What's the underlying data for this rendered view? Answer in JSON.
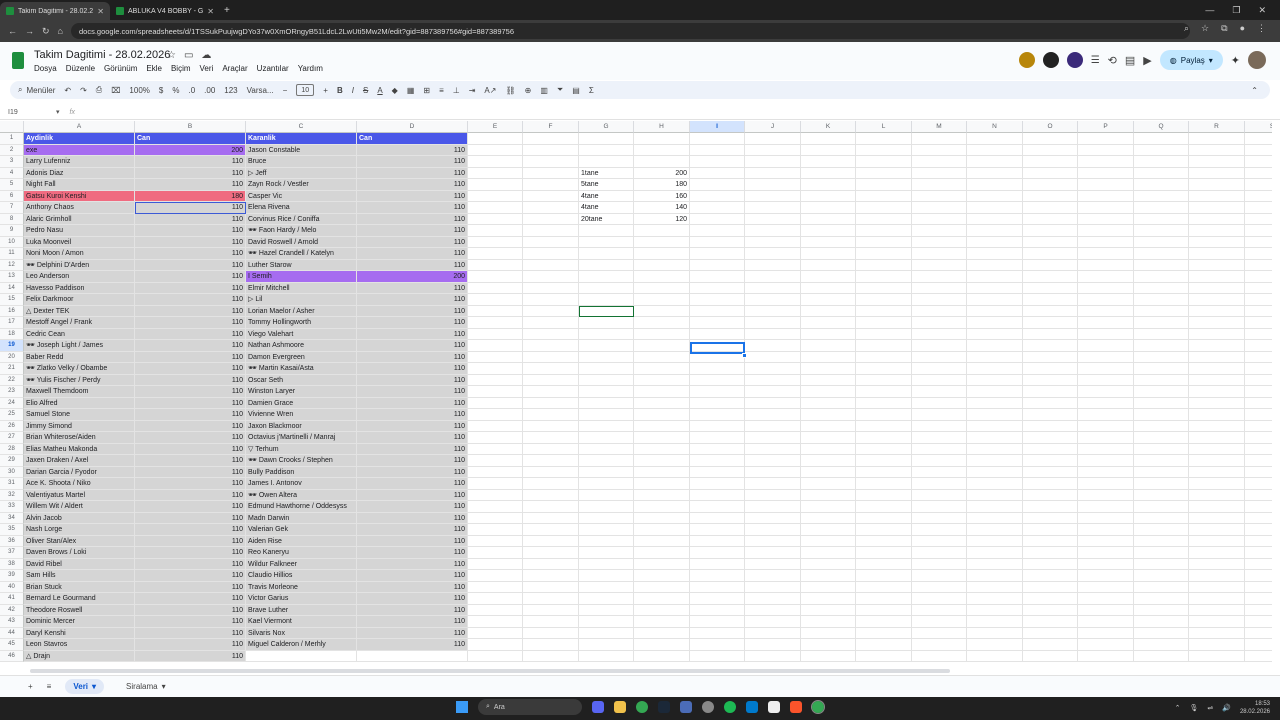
{
  "browser": {
    "tabs": [
      {
        "title": "Takim Dagitimi - 28.02.2026 - G",
        "active": true
      },
      {
        "title": "ABLUKA V4 BOBBY - Google E",
        "active": false
      }
    ],
    "url": "docs.google.com/spreadsheets/d/1TSSukPuujwgDYo37w0XmORngyB51LdcL2LwUti5Mw2M/edit?gid=887389756#gid=887389756"
  },
  "doc": {
    "title": "Takim Dagitimi - 28.02.2026",
    "menu": [
      "Dosya",
      "Düzenle",
      "Görünüm",
      "Ekle",
      "Biçim",
      "Veri",
      "Araçlar",
      "Uzantılar",
      "Yardım"
    ],
    "share_label": "Paylaş"
  },
  "toolbar": {
    "menus_label": "Menüler",
    "zoom": "100%",
    "currency": "$",
    "percent": "%",
    "dec_less": ".0",
    "dec_more": ".00",
    "number_format": "123",
    "font": "Varsa...",
    "font_size": "10"
  },
  "formula": {
    "cell_ref": "I19",
    "fx": "fx",
    "value": ""
  },
  "columns": [
    "A",
    "B",
    "C",
    "D",
    "E",
    "F",
    "G",
    "H",
    "I",
    "J",
    "K",
    "L",
    "M",
    "N",
    "O",
    "P",
    "Q",
    "R",
    "S"
  ],
  "selected_column": "I",
  "selected_row": 19,
  "headers": {
    "a": "Aydinlik",
    "b": "Can",
    "c": "Karanlik",
    "d": "Can"
  },
  "rows": [
    {
      "a": "exe",
      "b": "200",
      "c": "Jason Constable",
      "d": "110"
    },
    {
      "a": "Larry Lufenniz",
      "b": "110",
      "c": "Bruce",
      "d": "110"
    },
    {
      "a": "Adonis Diaz",
      "b": "110",
      "c": "▷ Jeff",
      "d": "110"
    },
    {
      "a": "Night Fall",
      "b": "110",
      "c": "Zayn Rock / Vestler",
      "d": "110"
    },
    {
      "a": "Gatsu Kuroi Kenshi",
      "b": "180",
      "c": "Casper Vic",
      "d": "110"
    },
    {
      "a": "Anthony Chaos",
      "b": "110",
      "c": "Elena Rivena",
      "d": "110"
    },
    {
      "a": "Alaric Grimholl",
      "b": "110",
      "c": "Corvinus Rice / Coniffa",
      "d": "110"
    },
    {
      "a": "Pedro Nasu",
      "b": "110",
      "c": "🕶 Faon Hardy / Melo",
      "d": "110"
    },
    {
      "a": "Luka Moonveil",
      "b": "110",
      "c": "David Roswell / Arnold",
      "d": "110"
    },
    {
      "a": "Noni Moon / Amon",
      "b": "110",
      "c": "🕶 Hazel Crandell / Katelyn",
      "d": "110"
    },
    {
      "a": "🕶 Delphini D'Arden",
      "b": "110",
      "c": "Luther Starow",
      "d": "110"
    },
    {
      "a": "Leo Anderson",
      "b": "110",
      "c": "I Semih",
      "d": "200"
    },
    {
      "a": "Havesso Paddison",
      "b": "110",
      "c": "Elmir Mitchell",
      "d": "110"
    },
    {
      "a": "Felix Darkmoor",
      "b": "110",
      "c": "▷ Lil",
      "d": "110"
    },
    {
      "a": "△ Dexter TEK",
      "b": "110",
      "c": "Lorian Maelor / Asher",
      "d": "110"
    },
    {
      "a": "Mestoff Angel / Frank",
      "b": "110",
      "c": "Tommy Hollingworth",
      "d": "110"
    },
    {
      "a": "Cedric Cean",
      "b": "110",
      "c": "Viego Valehart",
      "d": "110"
    },
    {
      "a": "🕶 Joseph Light / James",
      "b": "110",
      "c": "Nathan Ashmoore",
      "d": "110"
    },
    {
      "a": "Baber Redd",
      "b": "110",
      "c": "Damon Evergreen",
      "d": "110"
    },
    {
      "a": "🕶 Zlatko Velky / Obambe",
      "b": "110",
      "c": "🕶 Martin Kasai/Asta",
      "d": "110"
    },
    {
      "a": "🕶 Yulis Fischer / Perdy",
      "b": "110",
      "c": "Oscar Seth",
      "d": "110"
    },
    {
      "a": "Maxwell Themdoom",
      "b": "110",
      "c": "Winston Laryer",
      "d": "110"
    },
    {
      "a": "Elio Alfred",
      "b": "110",
      "c": "Damien Grace",
      "d": "110"
    },
    {
      "a": "Samuel Stone",
      "b": "110",
      "c": "Vivienne Wren",
      "d": "110"
    },
    {
      "a": "Jimmy Simond",
      "b": "110",
      "c": "Jaxon Blackmoor",
      "d": "110"
    },
    {
      "a": "Brian Whiterose/Aiden",
      "b": "110",
      "c": "Octavius j'Martinelli / Manraj",
      "d": "110"
    },
    {
      "a": "Elias Matheu Makonda",
      "b": "110",
      "c": "▽ Terhum",
      "d": "110"
    },
    {
      "a": "Jaxen Draken / Axel",
      "b": "110",
      "c": "🕶 Dawn Crooks / Stephen",
      "d": "110"
    },
    {
      "a": "Darian Garcia / Fyodor",
      "b": "110",
      "c": "Bully Paddison",
      "d": "110"
    },
    {
      "a": "Ace K. Shoota / Niko",
      "b": "110",
      "c": "James I. Antonov",
      "d": "110"
    },
    {
      "a": "Valentiyatus Martel",
      "b": "110",
      "c": "🕶 Owen Altera",
      "d": "110"
    },
    {
      "a": "Willem Wit / Aldert",
      "b": "110",
      "c": "Edmund Hawthorne / Oddesyss",
      "d": "110"
    },
    {
      "a": "Alvin Jacob",
      "b": "110",
      "c": "Madn Darwin",
      "d": "110"
    },
    {
      "a": "Nash Lorge",
      "b": "110",
      "c": "Valerian Gek",
      "d": "110"
    },
    {
      "a": "Oliver Stan/Alex",
      "b": "110",
      "c": "Aiden Rise",
      "d": "110"
    },
    {
      "a": "Daven Brows / Loki",
      "b": "110",
      "c": "Reo Kaneryu",
      "d": "110"
    },
    {
      "a": "David Ribel",
      "b": "110",
      "c": "Wildur Falkneer",
      "d": "110"
    },
    {
      "a": "Sam Hills",
      "b": "110",
      "c": "Claudio Hillios",
      "d": "110"
    },
    {
      "a": "Brian Stuck",
      "b": "110",
      "c": "Travis Morleone",
      "d": "110"
    },
    {
      "a": "Bernard Le Gourmand",
      "b": "110",
      "c": "Victor Garius",
      "d": "110"
    },
    {
      "a": "Theodore Roswell",
      "b": "110",
      "c": "Brave Luther",
      "d": "110"
    },
    {
      "a": "Dominic Mercer",
      "b": "110",
      "c": "Kael Viermont",
      "d": "110"
    },
    {
      "a": "Daryl Kenshi",
      "b": "110",
      "c": "Silvaris Nox",
      "d": "110"
    },
    {
      "a": "Leon Stavros",
      "b": "110",
      "c": "Miguel Calderon / Merhly",
      "d": "110"
    },
    {
      "a": "△ Drajn",
      "b": "110",
      "c": "",
      "d": ""
    }
  ],
  "summary": [
    {
      "label": "1tane",
      "value": "200"
    },
    {
      "label": "5tane",
      "value": "180"
    },
    {
      "label": "4tane",
      "value": "160"
    },
    {
      "label": "4tane",
      "value": "140"
    },
    {
      "label": "20tane",
      "value": "120"
    }
  ],
  "sheet_tabs": [
    {
      "label": "Veri",
      "active": true
    },
    {
      "label": "Siralama",
      "active": false
    }
  ],
  "taskbar": {
    "search_label": "Ara",
    "time": "18:53",
    "date": "28.02.2026"
  },
  "colors": {
    "header_blue": "#4a57e8",
    "purple": "#a66cf0",
    "red": "#f06b80",
    "grey": "#d5d5d5"
  }
}
